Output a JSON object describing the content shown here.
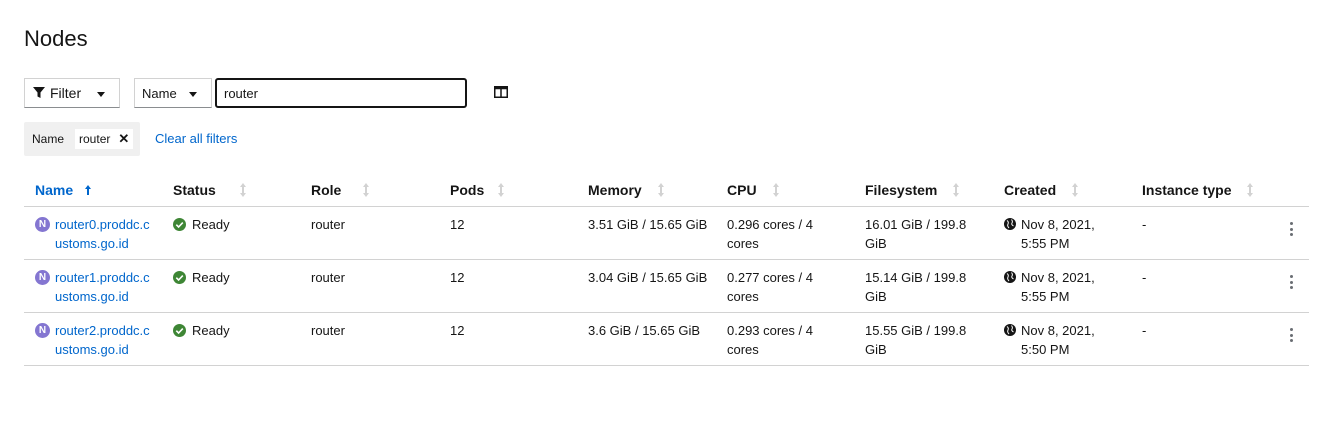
{
  "page": {
    "title": "Nodes"
  },
  "toolbar": {
    "filter_label": "Filter",
    "attribute_select": "Name",
    "search_value": "router"
  },
  "chips": {
    "category": "Name",
    "value": "router",
    "close_glyph": "✕",
    "clear_all": "Clear all filters"
  },
  "table": {
    "columns": [
      "Name",
      "Status",
      "Role",
      "Pods",
      "Memory",
      "CPU",
      "Filesystem",
      "Created",
      "Instance type"
    ],
    "sorted_column": "Name",
    "sort_direction": "ascending",
    "rows": [
      {
        "badge": "N",
        "name": "router0.proddc.customs.go.id",
        "status": "Ready",
        "role": "router",
        "pods": "12",
        "memory": "3.51 GiB / 15.65 GiB",
        "cpu": "0.296 cores / 4 cores",
        "filesystem": "16.01 GiB / 199.8 GiB",
        "created": "Nov 8, 2021, 5:55 PM",
        "instance_type": "-"
      },
      {
        "badge": "N",
        "name": "router1.proddc.customs.go.id",
        "status": "Ready",
        "role": "router",
        "pods": "12",
        "memory": "3.04 GiB / 15.65 GiB",
        "cpu": "0.277 cores / 4 cores",
        "filesystem": "15.14 GiB / 199.8 GiB",
        "created": "Nov 8, 2021, 5:55 PM",
        "instance_type": "-"
      },
      {
        "badge": "N",
        "name": "router2.proddc.customs.go.id",
        "status": "Ready",
        "role": "router",
        "pods": "12",
        "memory": "3.6 GiB / 15.65 GiB",
        "cpu": "0.293 cores / 4 cores",
        "filesystem": "15.55 GiB / 199.8 GiB",
        "created": "Nov 8, 2021, 5:50 PM",
        "instance_type": "-"
      }
    ]
  },
  "icons": {
    "filter": "filter-icon",
    "columns": "columns-icon",
    "status_ok": "check-circle-icon",
    "created": "globe-icon",
    "row_actions": "kebab-icon",
    "sort_active": "arrow-up-icon",
    "sort_inactive": "sort-arrows-icon"
  },
  "colors": {
    "link": "#0066cc",
    "success": "#3e8635",
    "node_badge": "#8476d1",
    "border": "#d2d2d2"
  }
}
